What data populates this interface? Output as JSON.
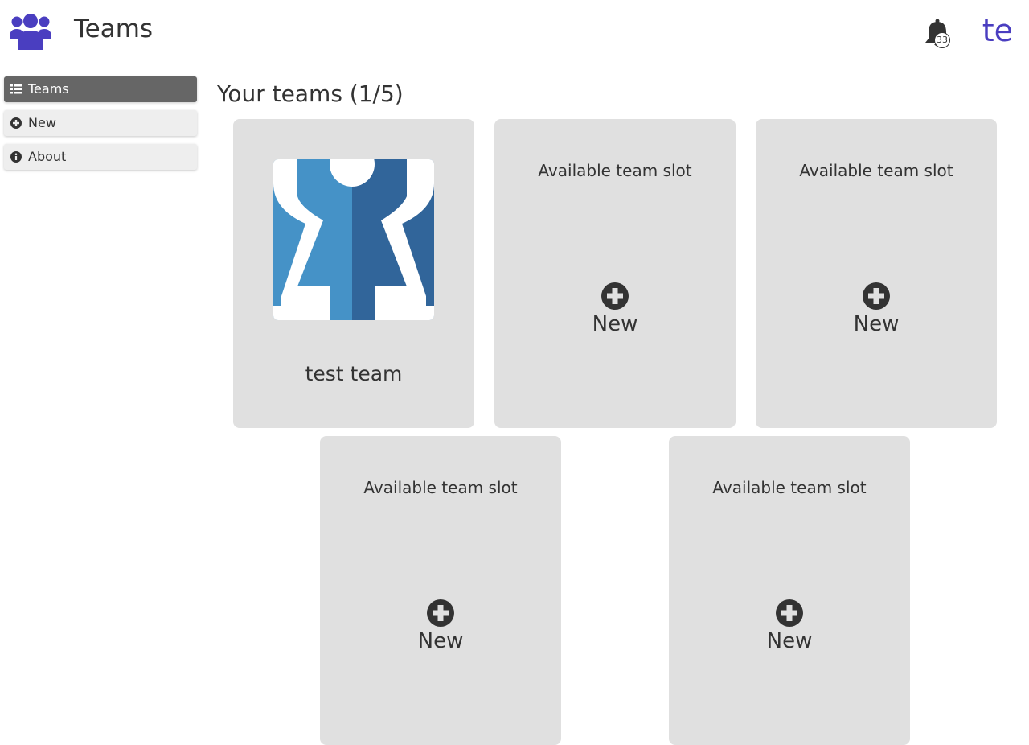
{
  "header": {
    "title": "Teams",
    "notification_count": "33",
    "user_initials": "te",
    "logo_icon": "users-icon",
    "bell_icon": "bell-icon"
  },
  "colors": {
    "accent": "#4a3ec0",
    "sidebar_active": "#666666",
    "card_bg": "#e0e0e0"
  },
  "sidebar": {
    "items": [
      {
        "label": "Teams",
        "icon": "list-icon",
        "active": true
      },
      {
        "label": "New",
        "icon": "plus-circle-icon",
        "active": false
      },
      {
        "label": "About",
        "icon": "info-circle-icon",
        "active": false
      }
    ]
  },
  "main": {
    "title": "Your teams (1/5)",
    "team": {
      "name": "test team"
    },
    "slots": [
      {
        "text": "Available team slot",
        "action": "New"
      },
      {
        "text": "Available team slot",
        "action": "New"
      },
      {
        "text": "Available team slot",
        "action": "New"
      },
      {
        "text": "Available team slot",
        "action": "New"
      }
    ]
  }
}
